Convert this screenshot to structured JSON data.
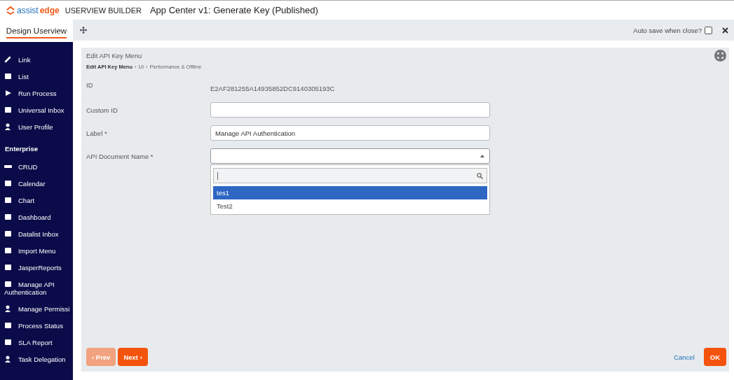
{
  "header": {
    "logo_prefix": "assist",
    "logo_suffix": "edge",
    "product": "USERVIEW BUILDER",
    "title": "App Center v1: Generate Key (Published)"
  },
  "sidebar": {
    "tab": "Design Userview",
    "items": [
      {
        "kind": "item",
        "label": "Link"
      },
      {
        "kind": "item",
        "label": "List"
      },
      {
        "kind": "item",
        "label": "Run Process"
      },
      {
        "kind": "item",
        "label": "Universal Inbox"
      },
      {
        "kind": "item",
        "label": "User Profile"
      },
      {
        "kind": "heading",
        "label": "Enterprise"
      },
      {
        "kind": "item",
        "label": "CRUD"
      },
      {
        "kind": "item",
        "label": "Calendar"
      },
      {
        "kind": "item",
        "label": "Chart"
      },
      {
        "kind": "item",
        "label": "Dashboard"
      },
      {
        "kind": "item",
        "label": "Datalist Inbox"
      },
      {
        "kind": "item",
        "label": "Import Menu"
      },
      {
        "kind": "item",
        "label": "JasperReports"
      },
      {
        "kind": "item",
        "label": "Manage API Authentication"
      },
      {
        "kind": "item",
        "label": "Manage Permissi"
      },
      {
        "kind": "item",
        "label": "Process Status"
      },
      {
        "kind": "item",
        "label": "SLA Report"
      },
      {
        "kind": "item",
        "label": "Task Delegation"
      }
    ]
  },
  "toolbar": {
    "auto_save_label": "Auto save when close?",
    "auto_save_checked": false
  },
  "panel": {
    "title": "Edit API Key Menu",
    "breadcrumb": [
      {
        "kind": "crumb",
        "label": "Edit API Key Menu"
      },
      {
        "kind": "separator",
        "label": "›"
      },
      {
        "kind": "crumb",
        "label": "UI"
      },
      {
        "kind": "separator",
        "label": "›"
      },
      {
        "kind": "crumb",
        "label": "Performance & Offline"
      }
    ],
    "fields": [
      {
        "kind": "static",
        "label": "ID",
        "value": "E2AF281255A14935852DC9140305193C"
      },
      {
        "kind": "input",
        "label": "Custom ID"
      },
      {
        "kind": "input",
        "label": "Label *",
        "value": "Manage API Authentication"
      },
      {
        "kind": "select",
        "label": "API Document Name *",
        "options": [
          {
            "label": "tes1",
            "selected": true
          },
          {
            "label": "Test2",
            "selected": false
          }
        ]
      }
    ],
    "buttons": {
      "prev": "‹ Prev",
      "next": "Next ›",
      "cancel": "Cancel",
      "ok": "OK"
    }
  }
}
